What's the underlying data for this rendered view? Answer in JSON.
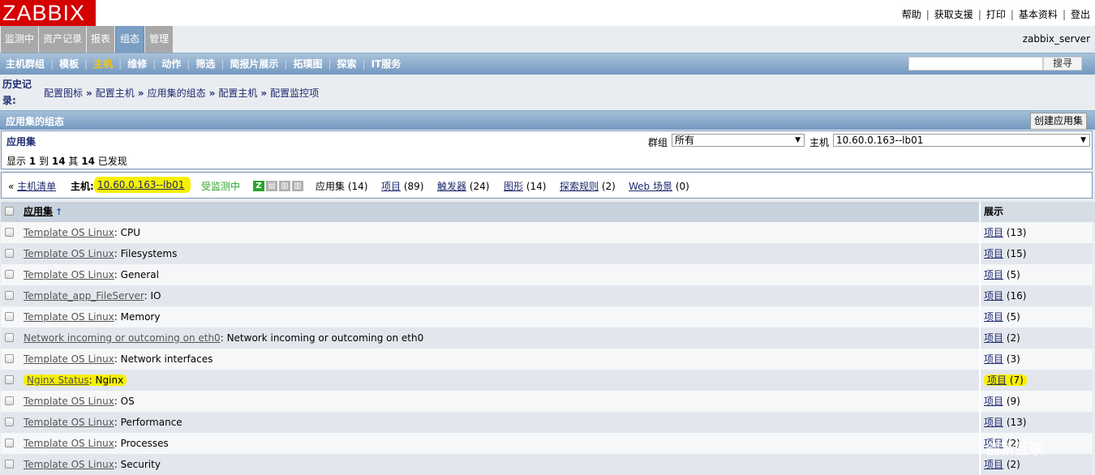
{
  "logo": "ZABBIX",
  "top_links": [
    "帮助",
    "获取支援",
    "打印",
    "基本资料",
    "登出"
  ],
  "main_tabs": [
    {
      "label": "监测中",
      "active": false
    },
    {
      "label": "资产记录",
      "active": false
    },
    {
      "label": "报表",
      "active": false
    },
    {
      "label": "组态",
      "active": true
    },
    {
      "label": "管理",
      "active": false
    }
  ],
  "server_name": "zabbix_server",
  "sub_nav": [
    {
      "label": "主机群组",
      "active": false
    },
    {
      "label": "模板",
      "active": false
    },
    {
      "label": "主机",
      "active": true
    },
    {
      "label": "维修",
      "active": false
    },
    {
      "label": "动作",
      "active": false
    },
    {
      "label": "筛选",
      "active": false
    },
    {
      "label": "简报片展示",
      "active": false
    },
    {
      "label": "拓璞图",
      "active": false
    },
    {
      "label": "探索",
      "active": false
    },
    {
      "label": "IT服务",
      "active": false
    }
  ],
  "search": {
    "value": "",
    "button": "搜寻"
  },
  "history": {
    "label": "历史记录:",
    "crumbs": [
      "配置图标",
      "配置主机",
      "应用集的组态",
      "配置主机",
      "配置监控项"
    ]
  },
  "section": {
    "title": "应用集的组态",
    "create_button": "创建应用集"
  },
  "filter": {
    "title": "应用集",
    "count_prefix": "显示",
    "count_from": "1",
    "count_to_word": "到",
    "count_to": "14",
    "count_of_word": "其",
    "count_total": "14",
    "count_suffix": "已发现",
    "group_label": "群组",
    "group_value": "所有",
    "host_label": "主机",
    "host_value": "10.60.0.163--lb01"
  },
  "host_nav": {
    "back_link": "主机清单",
    "host_label": "主机:",
    "host_name": "10.60.0.163--lb01",
    "status": "受监测中",
    "status_color": "#2aa52a",
    "availability_badges": [
      "Z",
      "SNMP",
      "JMX",
      "IPMI"
    ],
    "apps_label": "应用集",
    "apps_count": "(14)",
    "links": [
      {
        "label": "项目",
        "count": "(89)"
      },
      {
        "label": "触发器",
        "count": "(24)"
      },
      {
        "label": "图形",
        "count": "(14)"
      },
      {
        "label": "探索规则",
        "count": "(2)"
      },
      {
        "label": "Web 场景",
        "count": "(0)"
      }
    ]
  },
  "table": {
    "columns": [
      "应用集",
      "展示"
    ],
    "rows": [
      {
        "template": "Template OS Linux",
        "name": "CPU",
        "link": "项目",
        "count": "(13)",
        "highlight": false
      },
      {
        "template": "Template OS Linux",
        "name": "Filesystems",
        "link": "项目",
        "count": "(15)",
        "highlight": false
      },
      {
        "template": "Template OS Linux",
        "name": "General",
        "link": "项目",
        "count": "(5)",
        "highlight": false
      },
      {
        "template": "Template_app_FileServer",
        "name": "IO",
        "link": "项目",
        "count": "(16)",
        "highlight": false
      },
      {
        "template": "Template OS Linux",
        "name": "Memory",
        "link": "项目",
        "count": "(5)",
        "highlight": false
      },
      {
        "template": "Network incoming or outcoming on eth0",
        "name": "Network incoming or outcoming on eth0",
        "link": "项目",
        "count": "(2)",
        "highlight": false
      },
      {
        "template": "Template OS Linux",
        "name": "Network interfaces",
        "link": "项目",
        "count": "(3)",
        "highlight": false
      },
      {
        "template": "Nginx Status",
        "name": "Nginx",
        "link": "项目",
        "count": "(7)",
        "highlight": true
      },
      {
        "template": "Template OS Linux",
        "name": "OS",
        "link": "项目",
        "count": "(9)",
        "highlight": false
      },
      {
        "template": "Template OS Linux",
        "name": "Performance",
        "link": "项目",
        "count": "(13)",
        "highlight": false
      },
      {
        "template": "Template OS Linux",
        "name": "Processes",
        "link": "项目",
        "count": "(2)",
        "highlight": false
      },
      {
        "template": "Template OS Linux",
        "name": "Security",
        "link": "项目",
        "count": "(2)",
        "highlight": false
      }
    ]
  },
  "watermark": "创新互联"
}
